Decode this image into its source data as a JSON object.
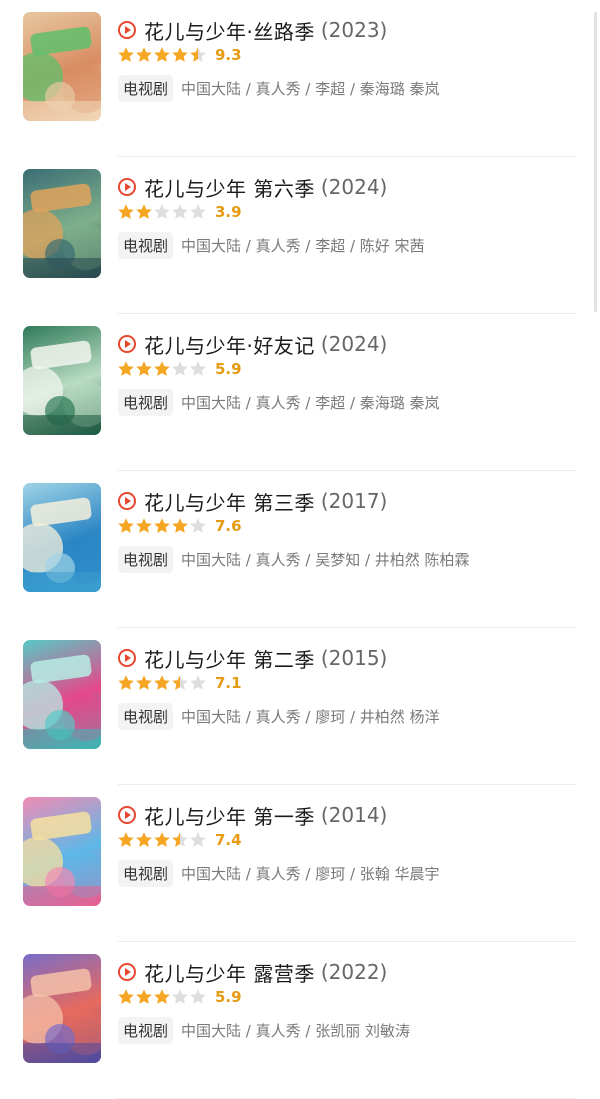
{
  "items": [
    {
      "title": "花儿与少年·丝路季",
      "year": "(2023)",
      "rating": 9.3,
      "stars": 4.5,
      "type": "电视剧",
      "meta": "中国大陆 / 真人秀 / 李超 / 秦海璐 秦岚",
      "poster_colors": [
        "#e7c8a0",
        "#d98c62",
        "#5fbf6b",
        "#f1d7b6"
      ]
    },
    {
      "title": "花儿与少年 第六季",
      "year": "(2024)",
      "rating": 3.9,
      "stars": 2,
      "type": "电视剧",
      "meta": "中国大陆 / 真人秀 / 李超 / 陈好 宋茜",
      "poster_colors": [
        "#3a6d74",
        "#7fb08b",
        "#e0a35b",
        "#28494f"
      ]
    },
    {
      "title": "花儿与少年·好友记",
      "year": "(2024)",
      "rating": 5.9,
      "stars": 3,
      "type": "电视剧",
      "meta": "中国大陆 / 真人秀 / 李超 / 秦海璐 秦岚",
      "poster_colors": [
        "#2f7a5a",
        "#b9dcc2",
        "#f2f4ee",
        "#1d5a42"
      ]
    },
    {
      "title": "花儿与少年 第三季",
      "year": "(2017)",
      "rating": 7.6,
      "stars": 4,
      "type": "电视剧",
      "meta": "中国大陆 / 真人秀 / 吴梦知 / 井柏然 陈柏霖",
      "poster_colors": [
        "#9fd3e6",
        "#2c86c4",
        "#f5f0dc",
        "#3a9fd0"
      ]
    },
    {
      "title": "花儿与少年 第二季",
      "year": "(2015)",
      "rating": 7.1,
      "stars": 3.5,
      "type": "电视剧",
      "meta": "中国大陆 / 真人秀 / 廖珂 / 井柏然 杨洋",
      "poster_colors": [
        "#57c9c5",
        "#e5488a",
        "#b7ece4",
        "#3db7b3"
      ]
    },
    {
      "title": "花儿与少年 第一季",
      "year": "(2014)",
      "rating": 7.4,
      "stars": 3.5,
      "type": "电视剧",
      "meta": "中国大陆 / 真人秀 / 廖珂 / 张翰 华晨宇",
      "poster_colors": [
        "#f08cb4",
        "#5cb8e8",
        "#f7e0a0",
        "#e85f8f"
      ]
    },
    {
      "title": "花儿与少年 露营季",
      "year": "(2022)",
      "rating": 5.9,
      "stars": 3,
      "type": "电视剧",
      "meta": "中国大陆 / 真人秀 / 张凯丽 刘敏涛",
      "poster_colors": [
        "#7a6cc8",
        "#e86a5c",
        "#f4c0a8",
        "#4f4aa0"
      ]
    }
  ],
  "colors": {
    "accent": "#e8472f",
    "star_filled": "#f5a623",
    "star_empty": "#dedede",
    "score": "#e69b12"
  }
}
